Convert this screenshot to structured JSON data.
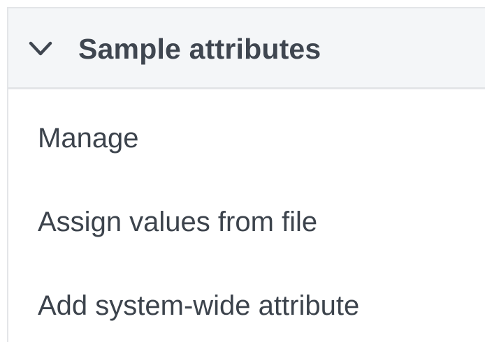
{
  "section": {
    "title": "Sample attributes",
    "expanded": true,
    "toggle_icon": "chevron-down-icon",
    "items": [
      {
        "label": "Manage"
      },
      {
        "label": "Assign values from file"
      },
      {
        "label": "Add system-wide attribute"
      }
    ]
  },
  "colors": {
    "header_background": "#f4f6f8",
    "border": "#e3e5e8",
    "text": "#3c434c"
  }
}
